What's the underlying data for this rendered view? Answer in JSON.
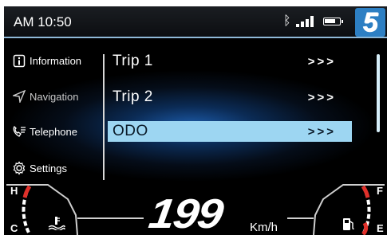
{
  "status": {
    "time": "AM 10:50",
    "icons": [
      "bluetooth-icon",
      "signal-icon",
      "battery-icon"
    ],
    "gear": "5"
  },
  "side_menu": [
    {
      "label": "Information",
      "icon": "info-icon"
    },
    {
      "label": "Navigation",
      "icon": "navigation-icon"
    },
    {
      "label": "Telephone",
      "icon": "phone-icon"
    },
    {
      "label": "Settings",
      "icon": "gear-icon"
    }
  ],
  "menu": [
    {
      "label": "Trip 1",
      "arrows": ">>>"
    },
    {
      "label": "Trip 2",
      "arrows": ">>>"
    },
    {
      "label": "ODO",
      "arrows": ">>>",
      "selected": true
    }
  ],
  "gauges": {
    "temp_high": "H",
    "temp_low": "C",
    "fuel_full": "F",
    "fuel_empty": "E",
    "speed": "199",
    "speed_unit": "Km/h"
  },
  "colors": {
    "selected_row": "#9dd6f2",
    "gear_badge": "#2d7fc3",
    "gauge_red": "#e0302a"
  }
}
